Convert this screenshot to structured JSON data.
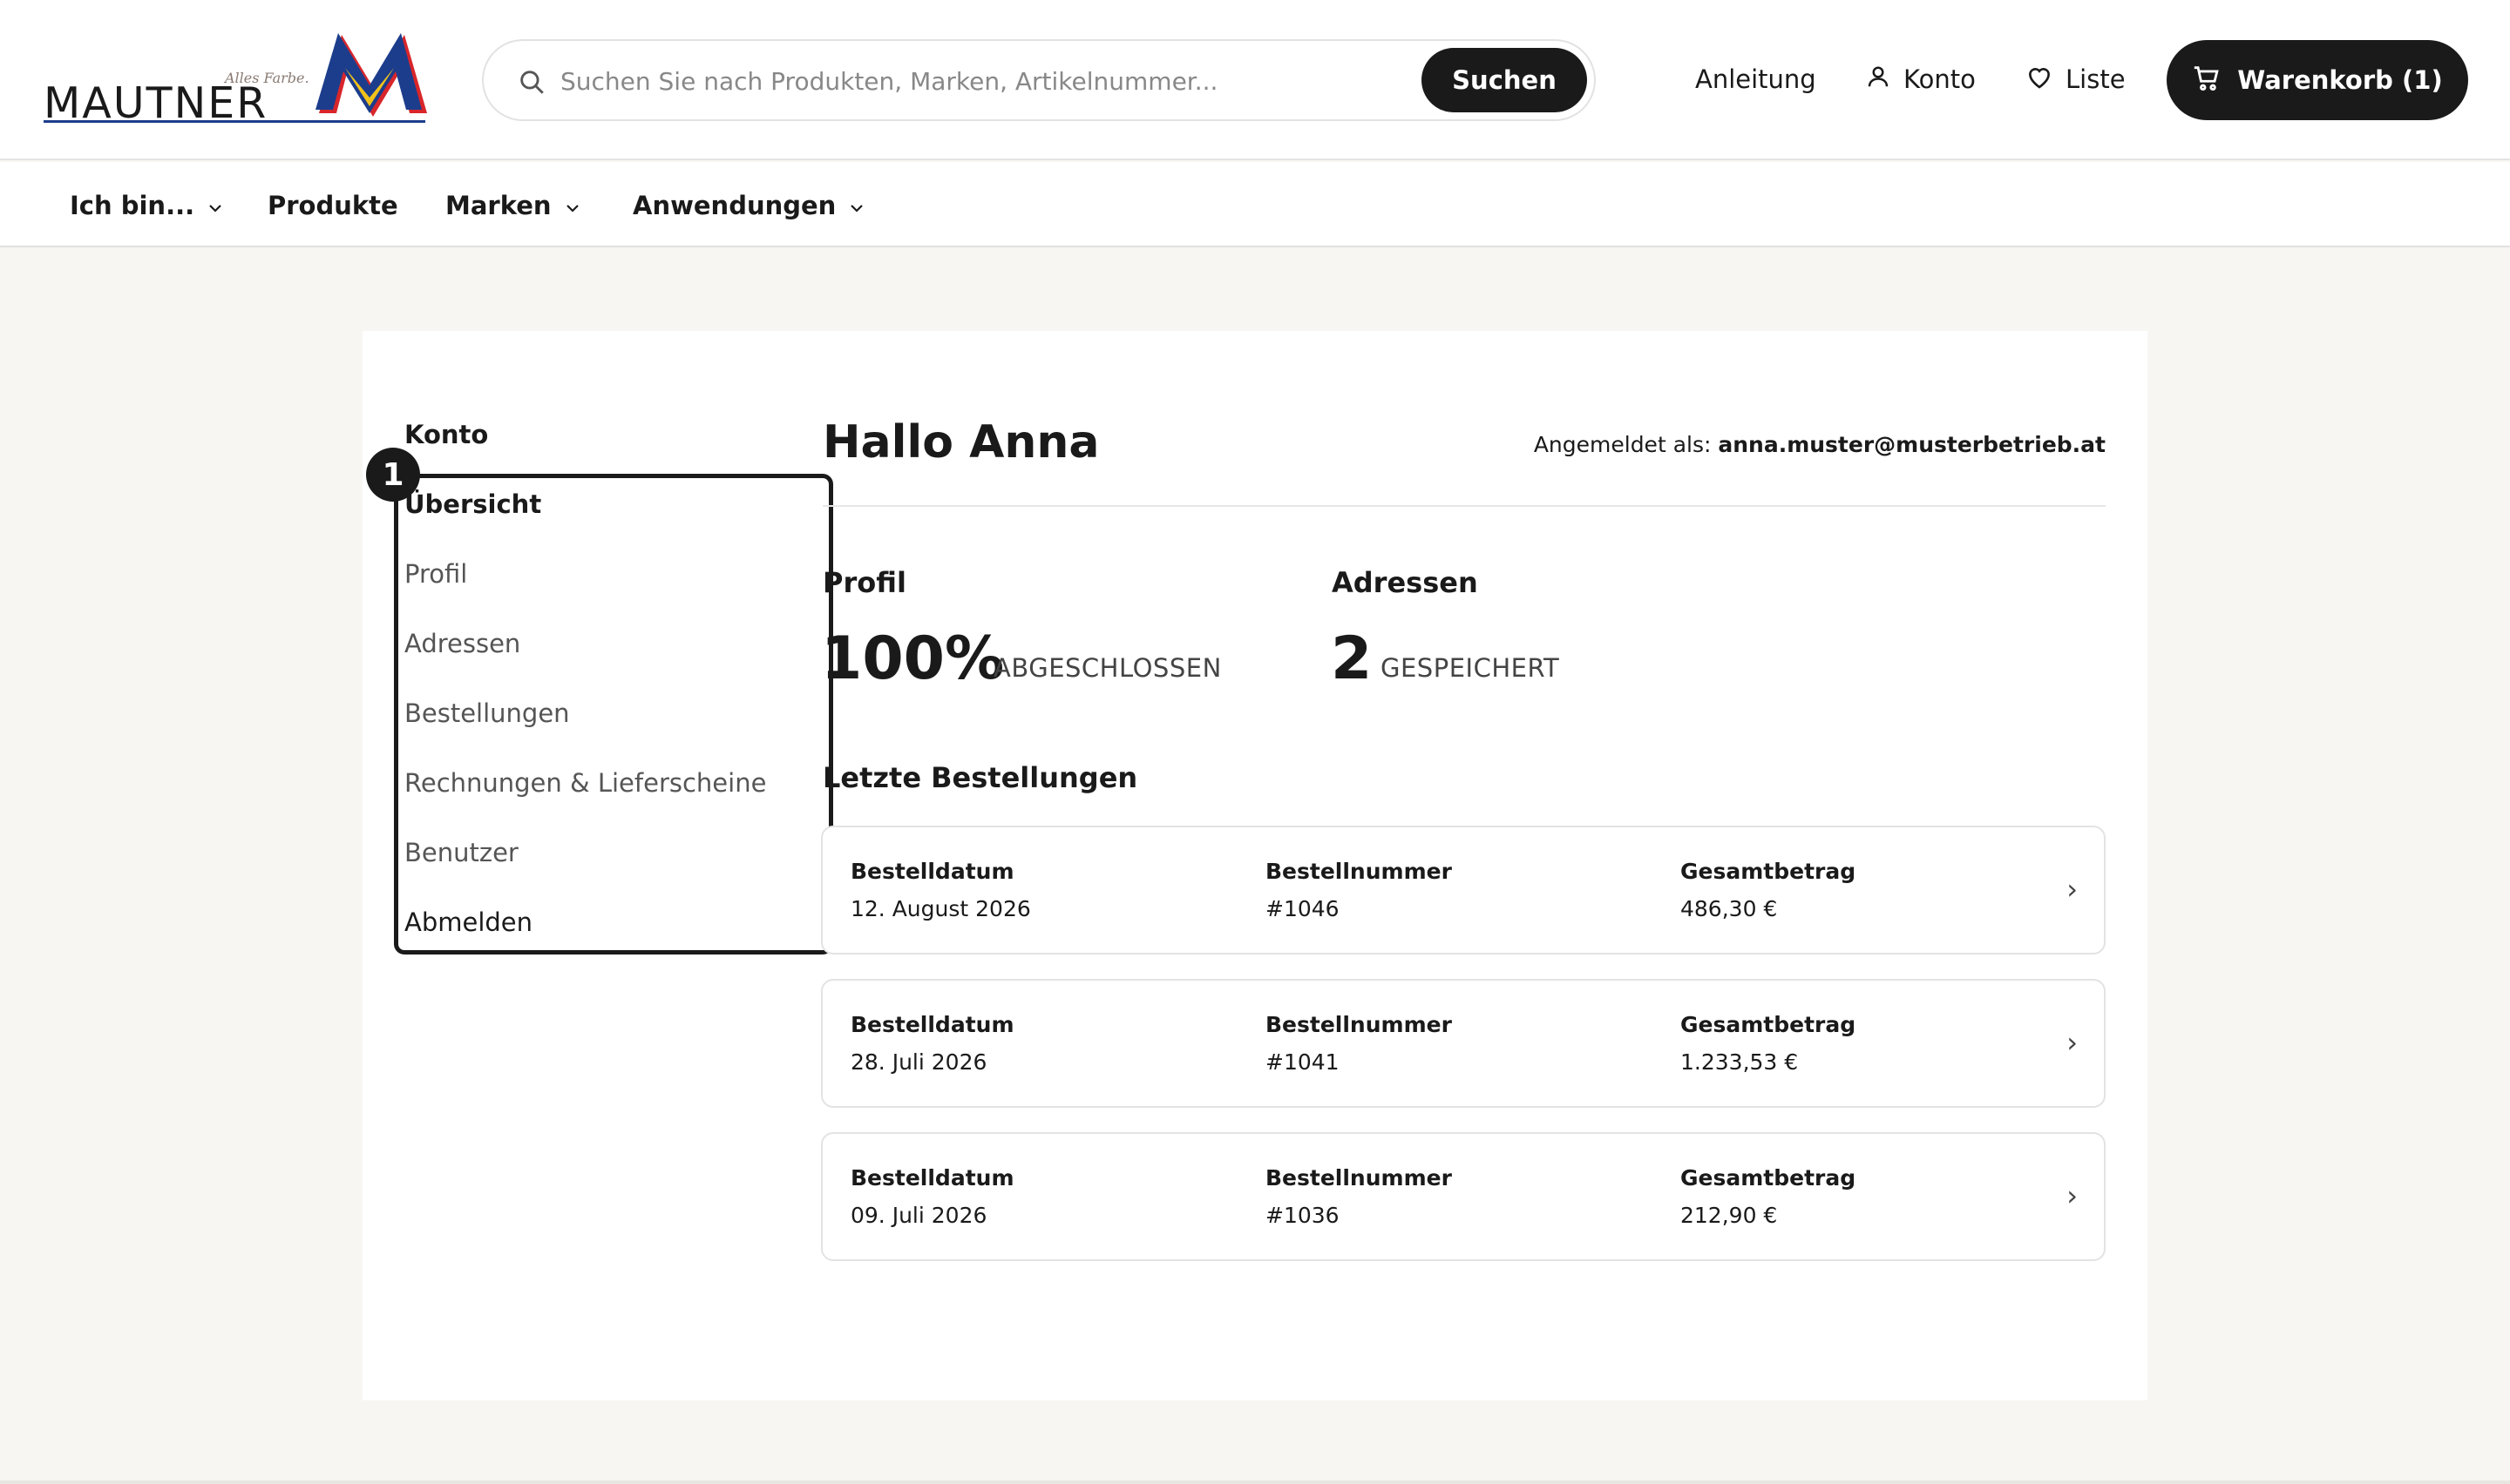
{
  "brand": {
    "name": "MAUTNER",
    "tagline": "Alles Farbe."
  },
  "search": {
    "placeholder": "Suchen Sie nach Produkten, Marken, Artikelnummer...",
    "button_label": "Suchen"
  },
  "header_links": {
    "guide": "Anleitung",
    "account": "Konto",
    "wishlist": "Liste",
    "cart": "Warenkorb (1)"
  },
  "nav": {
    "items": [
      {
        "label": "Ich bin...",
        "has_dropdown": true
      },
      {
        "label": "Produkte",
        "has_dropdown": false
      },
      {
        "label": "Marken",
        "has_dropdown": true
      },
      {
        "label": "Anwendungen",
        "has_dropdown": true
      }
    ]
  },
  "sidebar": {
    "title": "Konto",
    "items": [
      {
        "label": "Übersicht",
        "active": true
      },
      {
        "label": "Profil"
      },
      {
        "label": "Adressen"
      },
      {
        "label": "Bestellungen"
      },
      {
        "label": "Rechnungen & Lieferscheine"
      },
      {
        "label": "Benutzer"
      },
      {
        "label": "Abmelden"
      }
    ],
    "marker": "1"
  },
  "main": {
    "greeting": "Hallo Anna",
    "login_prefix": "Angemeldet als:",
    "login_email": "anna.muster@musterbetrieb.at",
    "stats": {
      "profile": {
        "label": "Profil",
        "value": "100%",
        "unit": "ABGESCHLOSSEN"
      },
      "addresses": {
        "label": "Adressen",
        "value": "2",
        "unit": "GESPEICHERT"
      }
    },
    "orders_title": "Letzte Bestellungen",
    "order_headers": {
      "date": "Bestelldatum",
      "number": "Bestellnummer",
      "total": "Gesamtbetrag"
    },
    "orders": [
      {
        "date": "12. August 2026",
        "number": "#1046",
        "total": "486,30 €"
      },
      {
        "date": "28. Juli 2026",
        "number": "#1041",
        "total": "1.233,53 €"
      },
      {
        "date": "09. Juli 2026",
        "number": "#1036",
        "total": "212,90 €"
      }
    ]
  },
  "colors": {
    "accent_dark": "#1a1a1a",
    "page_background": "#f7f6f2",
    "logo_blue": "#1c3d8c",
    "logo_yellow": "#f2c21b",
    "logo_red": "#d8262b"
  }
}
